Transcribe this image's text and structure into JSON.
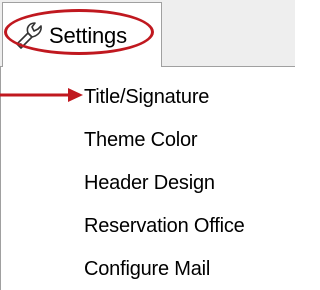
{
  "tab": {
    "label": "Settings",
    "icon": "wrench-icon"
  },
  "annotation_color": "#c0181f",
  "menu": {
    "items": [
      {
        "label": "Title/Signature",
        "highlighted_by_arrow": true
      },
      {
        "label": "Theme Color"
      },
      {
        "label": "Header Design"
      },
      {
        "label": "Reservation Office"
      },
      {
        "label": "Configure Mail"
      }
    ]
  }
}
